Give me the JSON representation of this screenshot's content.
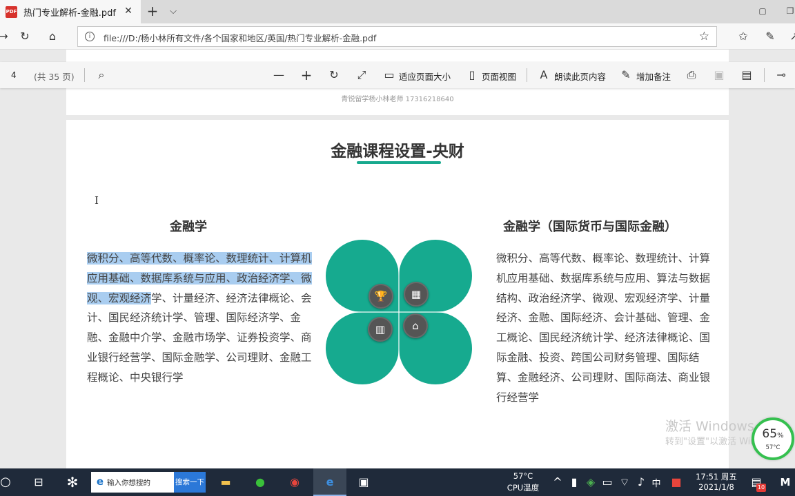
{
  "browser": {
    "tab_title": "热门专业解析-金融.pdf",
    "pdf_badge": "PDF",
    "url": "file:///D:/杨小林所有文件/各个国家和地区/英国/热门专业解析-金融.pdf"
  },
  "pdf_toolbar": {
    "page_number": "4",
    "page_total": "(共 35 页)",
    "fit_page_label": "适应页面大小",
    "page_view_label": "页面视图",
    "read_aloud_label": "朗读此页内容",
    "add_note_label": "增加备注"
  },
  "document": {
    "prev_footer": "青锐留学杨小林老师 17316218640",
    "title": "金融课程设置-央财",
    "left": {
      "heading": "金融学",
      "highlighted_text": "微积分、高等代数、概率论、数理统计、计算机应用基础、数据库系统与应用、政治经济学、微观、宏观经济",
      "rest_text": "学、计量经济、经济法律概论、会计、国民经济统计学、管理、国际经济学、金融、金融中介学、金融市场学、证券投资学、商业银行经营学、国际金融学、公司理财、金融工程概论、中央银行学"
    },
    "right": {
      "heading": "金融学（国际货币与国际金融）",
      "text": "微积分、高等代数、概率论、数理统计、计算机应用基础、数据库系统与应用、算法与数据结构、政治经济学、微观、宏观经济学、计量经济、金融、国际经济、会计基础、管理、金工概论、国民经济统计学、经济法律概论、国际金融、投资、跨国公司财务管理、国际结算、金融经济、公司理财、国际商法、商业银行经营学"
    },
    "accent_color": "#16aa8f"
  },
  "system": {
    "watermark_line1": "激活 Windows",
    "watermark_line2": "转到\"设置\"以激活 Windows。",
    "gauge_percent": "65",
    "gauge_percent_sign": "%",
    "gauge_temp": "57°C",
    "search_placeholder": "输入你想搜的",
    "search_button": "搜索一下",
    "cpu_temp": "57°C",
    "cpu_label": "CPU温度",
    "ime": "中",
    "time": "17:51 周五",
    "date": "2021/1/8",
    "notification_count": "10"
  }
}
